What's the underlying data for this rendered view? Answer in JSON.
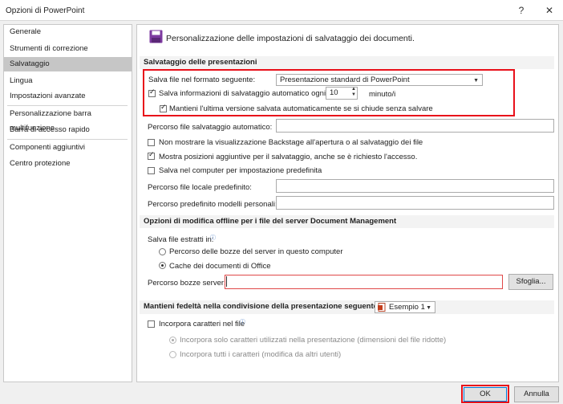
{
  "window": {
    "title": "Opzioni di PowerPoint",
    "help_glyph": "?",
    "close_glyph": "✕"
  },
  "sidebar": {
    "items": [
      {
        "label": "Generale"
      },
      {
        "label": "Strumenti di correzione"
      },
      {
        "label": "Salvataggio"
      },
      {
        "label": "Lingua"
      },
      {
        "label": "Impostazioni avanzate"
      },
      {
        "label": "Personalizzazione barra multifunzione"
      },
      {
        "label": "Barra di accesso rapido"
      },
      {
        "label": "Componenti aggiuntivi"
      },
      {
        "label": "Centro protezione"
      }
    ],
    "selected": "Salvataggio"
  },
  "main": {
    "heading": "Personalizzazione delle impostazioni di salvataggio dei documenti.",
    "save_section": {
      "title": "Salvataggio delle presentazioni",
      "format_label": "Salva file nel formato seguente:",
      "format_value": "Presentazione standard di PowerPoint",
      "autosave_label": "Salva informazioni di salvataggio automatico ogni",
      "autosave_checked": true,
      "autosave_minutes": "10",
      "autosave_unit": "minuto/i",
      "keep_last_label": "Mantieni l'ultima versione salvata automaticamente se si chiude senza salvare",
      "keep_last_checked": true,
      "autorecover_path_label": "Percorso file salvataggio automatico:",
      "autorecover_path_value": "",
      "no_backstage_label": "Non mostrare la visualizzazione Backstage all'apertura o al salvataggio dei file",
      "no_backstage_checked": false,
      "show_locations_label": "Mostra posizioni aggiuntive per il salvataggio, anche se è richiesto l'accesso.",
      "show_locations_checked": true,
      "save_to_computer_label": "Salva nel computer per impostazione predefinita",
      "save_to_computer_checked": false,
      "default_local_label": "Percorso file locale predefinito:",
      "default_local_value": "",
      "default_templates_label": "Percorso predefinito modelli personali:",
      "default_templates_value": ""
    },
    "offline_section": {
      "title": "Opzioni di modifica offline per i file del server Document Management",
      "save_checked_out_label": "Salva file estratti in:",
      "info_glyph": "ⓘ",
      "option_server_drafts": "Percorso delle bozze del server in questo computer",
      "option_office_cache": "Cache dei documenti di Office",
      "selected_option": "Cache dei documenti di Office",
      "drafts_path_label": "Percorso bozze server:",
      "drafts_path_value": "",
      "browse_label": "Sfoglia..."
    },
    "fidelity_section": {
      "title": "Mantieni fedeltà nella condivisione della presentazione seguente:",
      "presentation_value": "Esempio 1",
      "embed_fonts_label": "Incorpora caratteri nel file",
      "embed_fonts_checked": false,
      "embed_used_only_label": "Incorpora solo caratteri utilizzati nella presentazione (dimensioni del file ridotte)",
      "embed_all_label": "Incorpora tutti i caratteri (modifica da altri utenti)"
    }
  },
  "footer": {
    "ok_label": "OK",
    "cancel_label": "Annulla"
  },
  "colors": {
    "highlight_box": "#e8101a",
    "selected_nav": "#c6c6c6",
    "section_band": "#f3f3f3",
    "save_icon": "#7d3aa0"
  }
}
